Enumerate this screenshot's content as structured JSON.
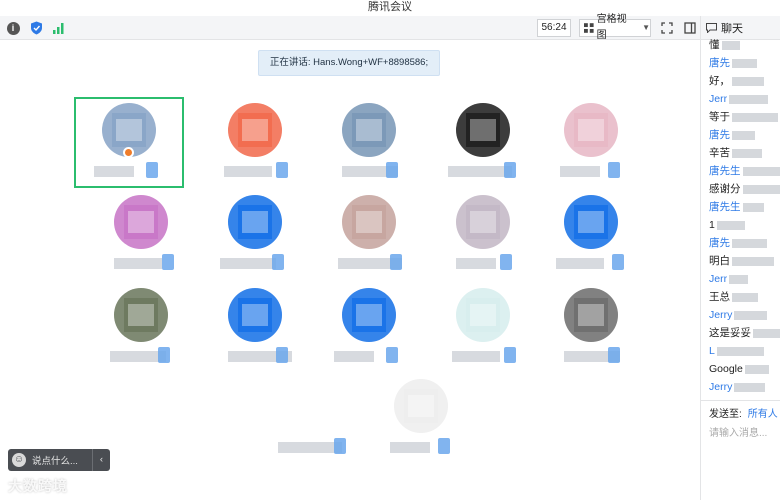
{
  "window": {
    "title": "腾讯会议"
  },
  "toolbar": {
    "info_icon": "info-icon",
    "shield_icon": "shield-icon",
    "signal_icon": "signal-icon",
    "timer": "56:24",
    "view_mode": "宫格视图",
    "fullscreen_icon": "fullscreen-icon",
    "sidebar_icon": "sidebar-toggle-icon"
  },
  "speaking": {
    "text": "正在讲话: Hans.Wong+WF+8898586;"
  },
  "chat": {
    "title": "聊天",
    "lines": [
      {
        "kind": "msg",
        "text": "懂"
      },
      {
        "kind": "name",
        "text": "唐先"
      },
      {
        "kind": "msg",
        "text": "好，"
      },
      {
        "kind": "name",
        "text": "Jerr"
      },
      {
        "kind": "msg",
        "text": "等于"
      },
      {
        "kind": "name",
        "text": "唐先"
      },
      {
        "kind": "msg",
        "text": "辛苦"
      },
      {
        "kind": "name",
        "text": "唐先生"
      },
      {
        "kind": "msg",
        "text": "感谢分"
      },
      {
        "kind": "name",
        "text": "唐先生"
      },
      {
        "kind": "msg",
        "text": "1"
      },
      {
        "kind": "name",
        "text": "唐先"
      },
      {
        "kind": "msg",
        "text": "明白"
      },
      {
        "kind": "name",
        "text": "Jerr"
      },
      {
        "kind": "msg",
        "text": "王总"
      },
      {
        "kind": "name",
        "text": "Jerry"
      },
      {
        "kind": "msg",
        "text": "这是妥妥"
      },
      {
        "kind": "name",
        "text": "L"
      },
      {
        "kind": "msg",
        "text": "Google"
      },
      {
        "kind": "name",
        "text": "Jerry"
      }
    ],
    "send_to_label": "发送至:",
    "send_to_target": "所有人",
    "input_placeholder": "请输入消息..."
  },
  "bottom": {
    "say_placeholder": "说点什么...",
    "collapse_icon": "chevron-left-icon",
    "smile_icon": "smile-icon"
  },
  "watermark": "大数跨境",
  "colors": {
    "accent": "#2e7ae6",
    "active_border": "#2bbd6e",
    "banner_bg": "#e3eef8"
  }
}
